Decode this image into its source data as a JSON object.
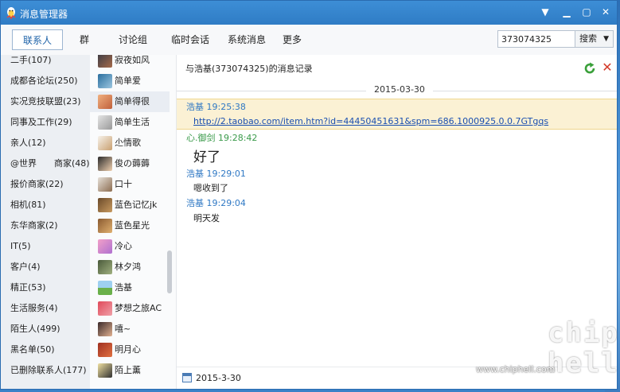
{
  "window": {
    "title": "消息管理器"
  },
  "toolbar": {
    "tabs": [
      "联系人",
      "群",
      "讨论组",
      "临时会话",
      "系统消息",
      "更多"
    ],
    "search_value": "373074325",
    "search_button": "搜索"
  },
  "groups": [
    "二手(107)",
    "成都各论坛(250)",
    "实况竞技联盟(23)",
    "同事及工作(29)",
    "亲人(12)",
    "@世界　　商家(48)",
    "报价商家(22)",
    "相机(81)",
    "东华商家(2)",
    "IT(5)",
    "客户(4)",
    "精正(53)",
    "生活服务(4)",
    "陌生人(499)",
    "黑名单(50)",
    "已删除联系人(177)"
  ],
  "contacts": [
    "寂夜如风",
    "简单爱",
    "简单得很",
    "简单生活",
    "尐情歌",
    "俊の薅薅",
    "口十",
    "蓝色记忆jk",
    "蓝色星光",
    "冷心",
    "林夕鸿",
    "浩基",
    "梦想之旅AC",
    "嘻~",
    "明月心",
    "陌上薰"
  ],
  "chat": {
    "header": "与浩基(373074325)的消息记录",
    "date_separator": "2015-03-30",
    "messages": [
      {
        "sender": "浩基",
        "time": "19:25:38",
        "text": "http://2.taobao.com/item.htm?id=44450451631&spm=686.1000925.0.0.7GTgqs"
      },
      {
        "sender": "心.御剑",
        "time": "19:28:42",
        "text": "好了"
      },
      {
        "sender": "浩基",
        "time": "19:29:01",
        "text": "嗯收到了"
      },
      {
        "sender": "浩基",
        "time": "19:29:04",
        "text": "明天发"
      }
    ],
    "footer_date": "2015-3-30"
  },
  "watermark": {
    "logo": "chip hell",
    "url": "www.chiphell.com"
  },
  "colors": {
    "title_bar": "#2f7cc5",
    "link": "#1a4fb0",
    "sender_blue": "#2f78c4",
    "sender_green": "#3a9a4a",
    "highlight": "#fbf1d4"
  }
}
